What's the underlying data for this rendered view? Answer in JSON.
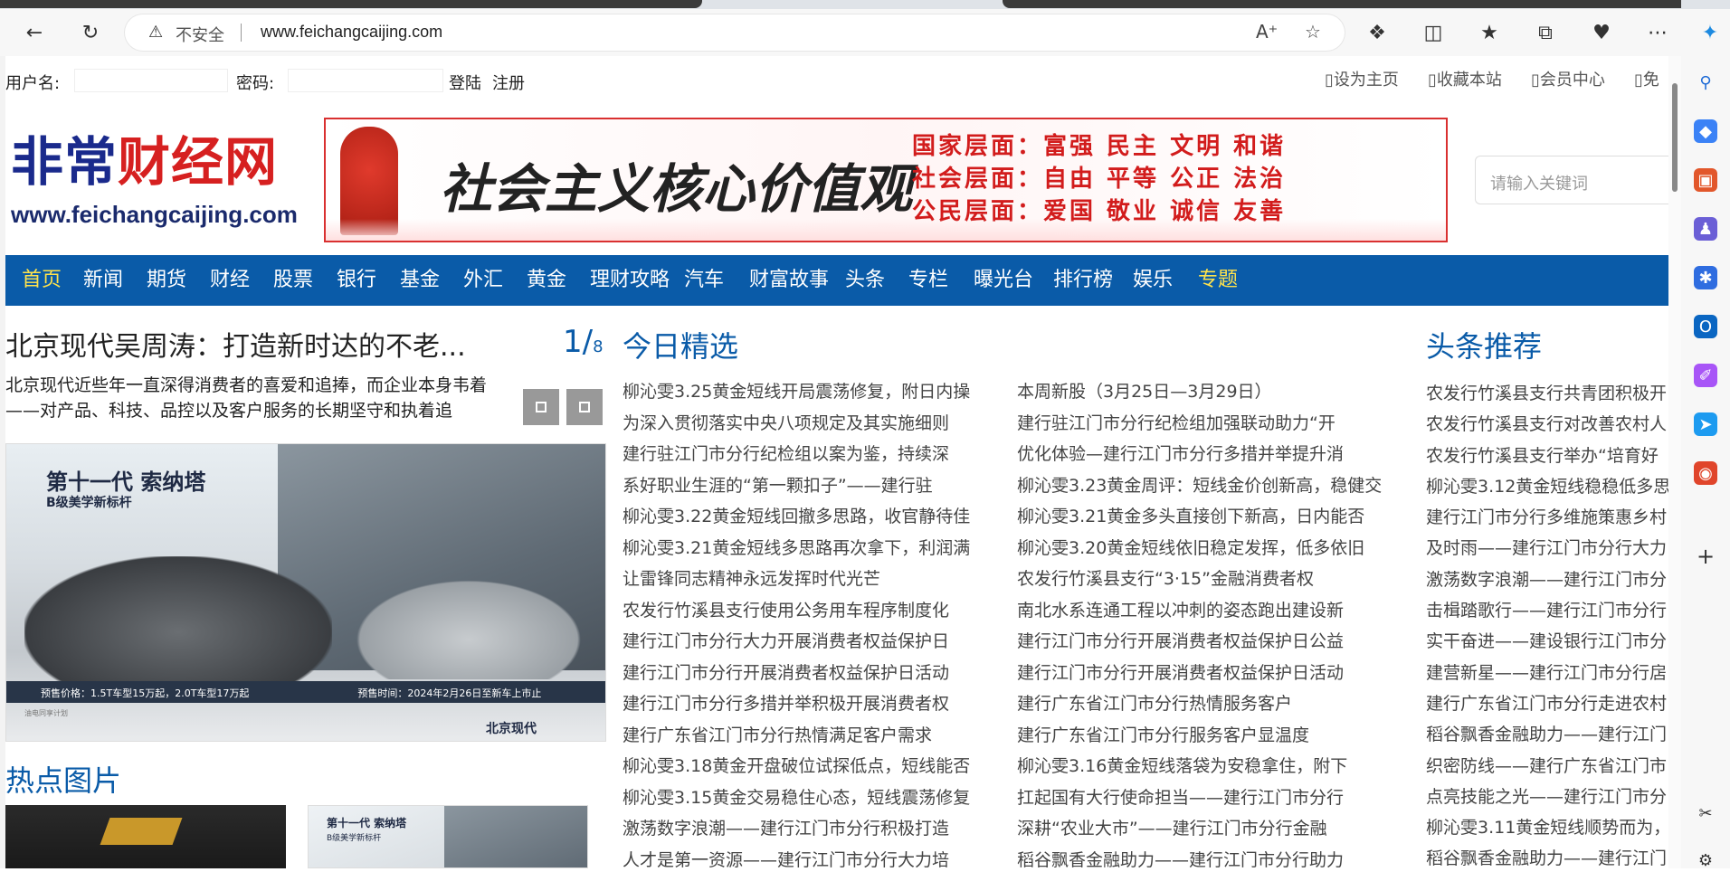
{
  "browser": {
    "security_label": "不安全",
    "url": "www.feichangcaijing.com"
  },
  "login": {
    "username_label": "用户名:",
    "password_label": "密码:",
    "login_button": "登陆",
    "register_link": "注册",
    "top_links": [
      "设为主页",
      "收藏本站",
      "会员中心",
      "免"
    ]
  },
  "logo": {
    "cn_part1": "非常",
    "cn_part2": "财经网",
    "en": "www.feichangcaijing.com"
  },
  "banner": {
    "slogan": "社会主义核心价值观",
    "values": [
      "国家层面：富强 民主 文明 和谐",
      "社会层面：自由 平等 公正 法治",
      "公民层面：爱国 敬业 诚信 友善"
    ]
  },
  "search": {
    "placeholder": "请输入关键词"
  },
  "nav": {
    "items": [
      "首页",
      "新闻",
      "期货",
      "财经",
      "股票",
      "银行",
      "基金",
      "外汇",
      "黄金",
      "理财攻略",
      "汽车",
      "财富故事",
      "头条",
      "专栏",
      "曝光台",
      "排行榜",
      "娱乐",
      "专题"
    ],
    "active_index": 0
  },
  "slide": {
    "title": "北京现代吴周涛：打造新时达的不老...",
    "pager_current": "1",
    "pager_total": "8",
    "desc": "北京现代近些年一直深得消费者的喜爱和追捧，而企业本身韦着——对产品、科技、品控以及客户服务的长期坚守和执着追",
    "image": {
      "headline": "第十一代 索纳塔",
      "subline": "B级美学新标杆",
      "price_strip": "预售价格：1.5T车型15万起，2.0T车型17万起",
      "date_strip": "预售时间：2024年2月26日至新车上市止",
      "fine": "油电同享计划",
      "brand": "北京现代"
    }
  },
  "hot_pictures": {
    "title": "热点图片",
    "thumb2_title": "第十一代 索纳塔",
    "thumb2_sub": "B级美学新标杆"
  },
  "today": {
    "title": "今日精选",
    "col1": [
      "柳沁雯3.25黄金短线开局震荡修复，附日内操",
      "为深入贯彻落实中央八项规定及其实施细则",
      "建行驻江门市分行纪检组以案为鉴，持续深",
      "系好职业生涯的“第一颗扣子”——建行驻",
      "柳沁雯3.22黄金短线回撤多思路，收官静待佳",
      "柳沁雯3.21黄金短线多思路再次拿下，利润满",
      "让雷锋同志精神永远发挥时代光芒",
      "农发行竹溪县支行使用公务用车程序制度化",
      "建行江门市分行大力开展消费者权益保护日",
      "建行江门市分行开展消费者权益保护日活动",
      "建行江门市分行多措并举积极开展消费者权",
      "建行广东省江门市分行热情满足客户需求",
      "柳沁雯3.18黄金开盘破位试探低点，短线能否",
      "柳沁雯3.15黄金交易稳住心态，短线震荡修复",
      "激荡数字浪潮——建行江门市分行积极打造",
      "人才是第一资源——建行江门市分行大力培"
    ],
    "col2": [
      "本周新股（3月25日—3月29日）",
      "建行驻江门市分行纪检组加强联动助力“开",
      "优化体验—建行江门市分行多措并举提升消",
      "柳沁雯3.23黄金周评：短线金价创新高，稳健交",
      "柳沁雯3.21黄金多头直接创下新高，日内能否",
      "柳沁雯3.20黄金短线依旧稳定发挥，低多依旧",
      "农发行竹溪县支行“3·15”金融消费者权",
      "南北水系连通工程以冲刺的姿态跑出建设新",
      "建行江门市分行开展消费者权益保护日公益",
      "建行江门市分行开展消费者权益保护日活动",
      "建行广东省江门市分行热情服务客户",
      "建行广东省江门市分行服务客户显温度",
      "柳沁雯3.16黄金短线落袋为安稳拿住，附下",
      "扛起国有大行使命担当——建行江门市分行",
      "深耕“农业大市”——建行江门市分行金融",
      "稻谷飘香金融助力——建行江门市分行助力"
    ]
  },
  "headlines": {
    "title": "头条推荐",
    "items": [
      "农发行竹溪县支行共青团积极开",
      "农发行竹溪县支行对改善农村人",
      "农发行竹溪县支行举办“培育好",
      "柳沁雯3.12黄金短线稳稳低多思",
      "建行江门市分行多维施策惠乡村",
      "及时雨——建行江门市分行大力",
      "激荡数字浪潮——建行江门市分",
      "击楫踏歌行——建行江门市分行",
      "实干奋进——建设银行江门市分",
      "建营新星——建行江门市分行扂",
      "建行广东省江门市分行走进农村",
      "稻谷飘香金融助力——建行江门",
      "织密防线——建行广东省江门市",
      "点亮技能之光——建行江门市分",
      "柳沁雯3.11黄金短线顺势而为，",
      "稻谷飘香金融助力——建行江门"
    ]
  },
  "colors": {
    "nav_bg": "#0a5ba8",
    "nav_active": "#ffe34c",
    "logo_blue": "#1a2a8c",
    "logo_red": "#d62020",
    "title_blue": "#0a5ba8"
  }
}
